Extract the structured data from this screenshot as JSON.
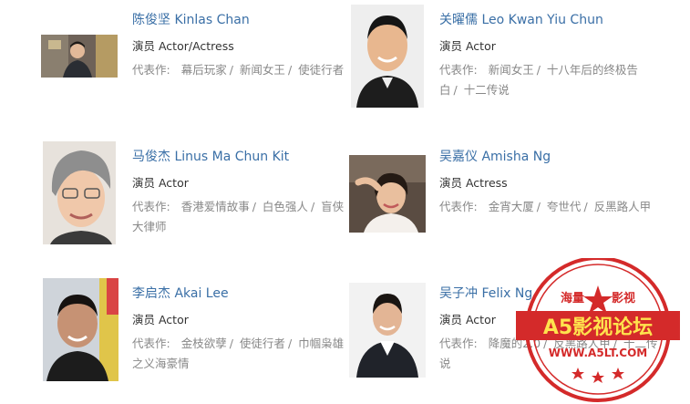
{
  "actors": [
    {
      "id": "kinlas",
      "name": "陈俊坚 Kinlas Chan",
      "role": "演员 Actor/Actress",
      "works_label": "代表作:",
      "works": [
        "幕后玩家",
        "新闻女王",
        "使徒行者"
      ],
      "photo_icon": "person-photo-icon"
    },
    {
      "id": "leo",
      "name": "关曜儒 Leo Kwan Yiu Chun",
      "role": "演员 Actor",
      "works_label": "代表作:",
      "works": [
        "新闻女王",
        "十八年后的终极告白",
        "十二传说"
      ],
      "photo_icon": "person-photo-icon"
    },
    {
      "id": "linus",
      "name": "马俊杰 Linus Ma Chun Kit",
      "role": "演员 Actor",
      "works_label": "代表作:",
      "works": [
        "香港爱情故事",
        "白色强人",
        "盲侠大律师"
      ],
      "photo_icon": "person-photo-icon"
    },
    {
      "id": "amisha",
      "name": "吴嘉仪 Amisha Ng",
      "role": "演员 Actress",
      "works_label": "代表作:",
      "works": [
        "金宵大厦",
        "夸世代",
        "反黑路人甲"
      ],
      "photo_icon": "person-photo-icon"
    },
    {
      "id": "akai",
      "name": "李启杰 Akai Lee",
      "role": "演员 Actor",
      "works_label": "代表作:",
      "works": [
        "金枝欲孽",
        "使徒行者",
        "巾帼枭雄之义海豪情"
      ],
      "photo_icon": "person-photo-icon"
    },
    {
      "id": "felix",
      "name": "吴子冲 Felix Ng",
      "role": "演员 Actor",
      "works_label": "代表作:",
      "works": [
        "降魔的2.0",
        "反黑路人甲",
        "十二传说"
      ],
      "photo_icon": "person-photo-icon"
    }
  ],
  "watermark": {
    "top_left": "海量",
    "top_right": "影视",
    "main": "A5影视论坛",
    "url": "WWW.A5LT.COM",
    "color": "#d42a2a"
  }
}
